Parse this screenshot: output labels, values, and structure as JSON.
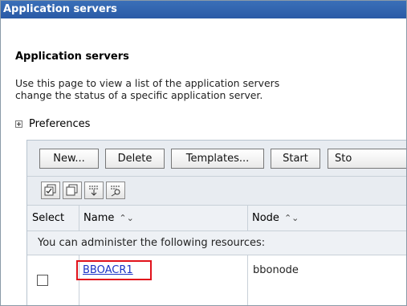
{
  "window": {
    "title": "Application servers"
  },
  "page": {
    "heading": "Application servers",
    "description_line1": "Use this page to view a list of the application servers",
    "description_line2": "change the status of a specific application server.",
    "preferences_label": "Preferences"
  },
  "toolbar": {
    "buttons": [
      "New...",
      "Delete",
      "Templates...",
      "Start",
      "Sto"
    ],
    "icons": [
      "select-all-icon",
      "deselect-all-icon",
      "expand-filter-icon",
      "filter-edit-icon"
    ]
  },
  "table": {
    "headers": {
      "select": "Select",
      "name": "Name",
      "node": "Node"
    },
    "note": "You can administer the following resources:",
    "rows": [
      {
        "name": "BBOACR1",
        "node": "bbonode"
      }
    ]
  },
  "colors": {
    "titlebar": "#2a5aa6",
    "highlight_border": "#e1121b",
    "link": "#1c34c6"
  }
}
